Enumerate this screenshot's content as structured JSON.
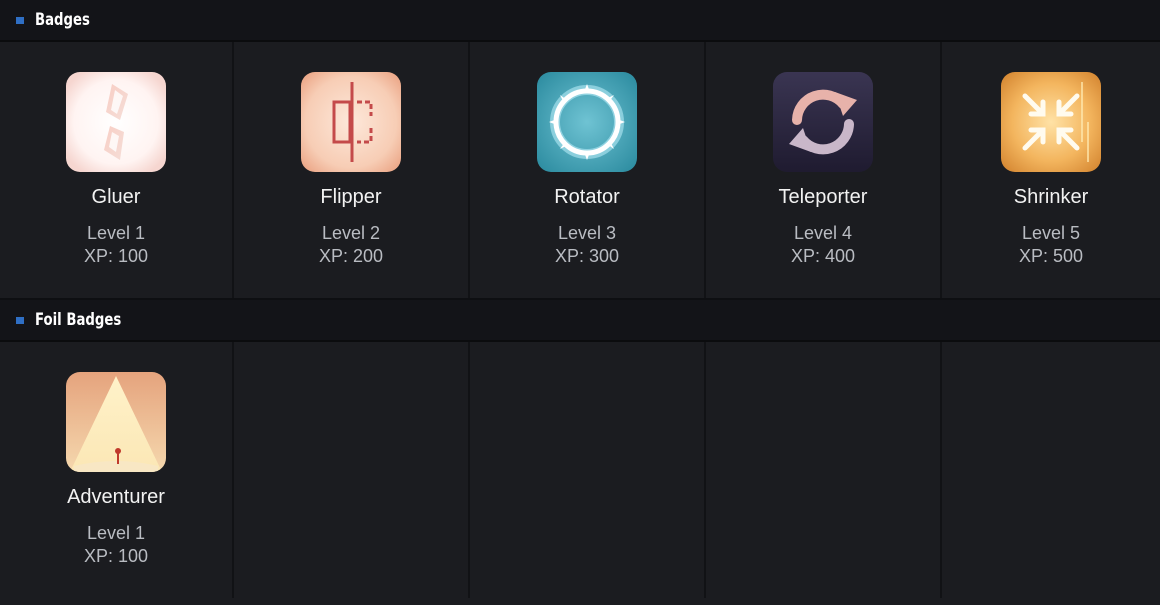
{
  "sections": [
    {
      "title": "Badges",
      "badges": [
        {
          "name": "Gluer",
          "level": "Level 1",
          "xp": "XP: 100",
          "icon": "gluer-icon"
        },
        {
          "name": "Flipper",
          "level": "Level 2",
          "xp": "XP: 200",
          "icon": "flipper-icon"
        },
        {
          "name": "Rotator",
          "level": "Level 3",
          "xp": "XP: 300",
          "icon": "rotator-icon"
        },
        {
          "name": "Teleporter",
          "level": "Level 4",
          "xp": "XP: 400",
          "icon": "teleporter-icon"
        },
        {
          "name": "Shrinker",
          "level": "Level 5",
          "xp": "XP: 500",
          "icon": "shrinker-icon"
        }
      ]
    },
    {
      "title": "Foil Badges",
      "badges": [
        {
          "name": "Adventurer",
          "level": "Level 1",
          "xp": "XP: 100",
          "icon": "adventurer-icon"
        }
      ]
    }
  ],
  "colors": {
    "background": "#1b1c20",
    "header_background": "#131418",
    "accent_marker": "#2f6fc4"
  }
}
